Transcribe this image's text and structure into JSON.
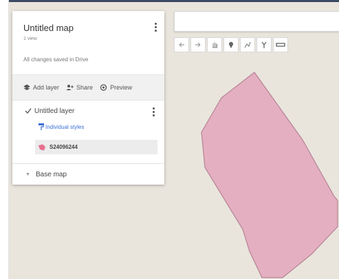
{
  "map": {
    "title": "Untitled map",
    "views": "1 view",
    "save_status": "All changes saved in Drive"
  },
  "actions": [
    {
      "label": "Add layer",
      "icon": "add-layer-icon"
    },
    {
      "label": "Share",
      "icon": "share-person-icon"
    },
    {
      "label": "Preview",
      "icon": "eye-icon"
    }
  ],
  "layer": {
    "checked": true,
    "name": "Untitled layer",
    "style_link": "Individual styles",
    "feature_label": "S24096244",
    "feature_color": "#e8708e"
  },
  "basemap": {
    "label": "Base map"
  },
  "toolbar": {
    "tools": [
      "undo-icon",
      "redo-icon",
      "hand-icon",
      "marker-icon",
      "draw-line-icon",
      "directions-icon",
      "ruler-icon"
    ]
  },
  "colors": {
    "polygon_fill": "#e4afc0",
    "polygon_stroke": "#b58494",
    "map_background": "#e9e5dd",
    "link_blue": "#3d6fd6"
  }
}
